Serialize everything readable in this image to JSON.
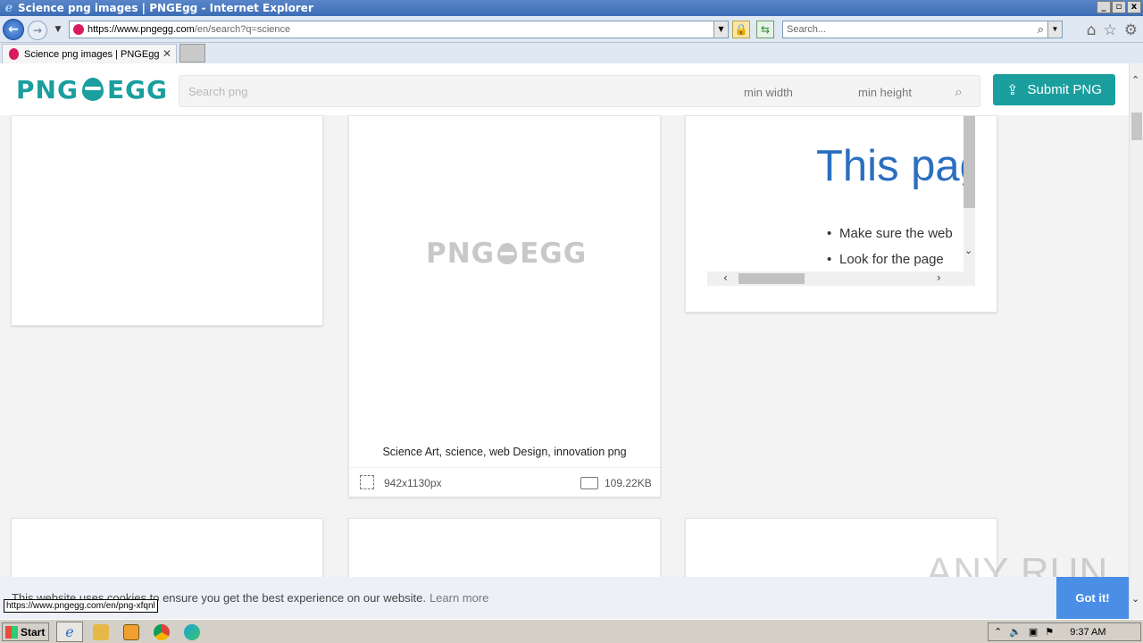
{
  "window": {
    "title": "Science png images | PNGEgg - Internet Explorer",
    "controls": {
      "minimize": "_",
      "maximize": "▫",
      "close": "x"
    }
  },
  "address_bar": {
    "url_host": "https://www.pngegg.com",
    "url_path": "/en/search?q=science",
    "search_placeholder": "Search..."
  },
  "tabs": [
    {
      "label": "Science png images | PNGEgg"
    }
  ],
  "site": {
    "logo_left": "PNG",
    "logo_right": "EGG",
    "search_placeholder": "Search png",
    "min_width": "min width",
    "min_height": "min height",
    "submit_label": "Submit PNG"
  },
  "cards": [
    {
      "title": "Science Art, science, web Design, innovation png",
      "dimensions": "942x1130px",
      "size": "109.22KB"
    }
  ],
  "error_frame": {
    "title": "This pag",
    "items": [
      "Make sure the web",
      "Look for the page"
    ]
  },
  "cookie": {
    "message": "This website uses cookies to ensure you get the best experience on our website.",
    "learn_more": "Learn more",
    "accept": "Got it!"
  },
  "status_bar_url": "https://www.pngegg.com/en/png-xfqnl",
  "watermark": "ANY RUN",
  "taskbar": {
    "start": "Start",
    "clock": "9:37 AM"
  },
  "colors": {
    "brand": "#1a9e9e",
    "accept_button": "#4a8ee6",
    "error_title": "#2b6fbf"
  }
}
